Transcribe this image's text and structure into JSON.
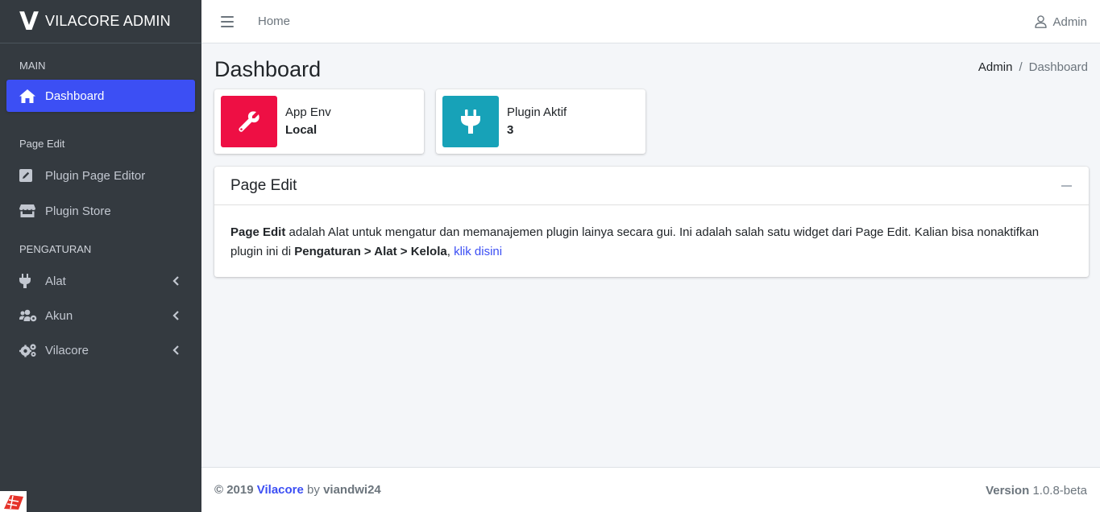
{
  "brand": {
    "logo": "V",
    "name": "VILACORE ADMIN"
  },
  "sidebar": {
    "sections": [
      {
        "header": "MAIN"
      },
      {
        "header": "Page Edit"
      },
      {
        "header": "PENGATURAN"
      }
    ],
    "items": [
      {
        "label": "Dashboard",
        "icon": "home-icon",
        "active": true
      },
      {
        "label": "Plugin Page Editor",
        "icon": "edit-icon"
      },
      {
        "label": "Plugin Store",
        "icon": "store-icon"
      },
      {
        "label": "Alat",
        "icon": "plug-icon",
        "expandable": true
      },
      {
        "label": "Akun",
        "icon": "users-cog-icon",
        "expandable": true
      },
      {
        "label": "Vilacore",
        "icon": "cogs-icon",
        "expandable": true
      }
    ]
  },
  "topbar": {
    "home_label": "Home",
    "user_label": "Admin"
  },
  "page": {
    "title": "Dashboard",
    "breadcrumb": {
      "home": "Admin",
      "separator": "/",
      "current": "Dashboard"
    }
  },
  "info_boxes": [
    {
      "label": "App Env",
      "value": "Local",
      "icon": "wrench-icon",
      "color": "#ee0f44"
    },
    {
      "label": "Plugin Aktif",
      "value": "3",
      "icon": "plug-icon",
      "color": "#17a2b8"
    }
  ],
  "card": {
    "title": "Page Edit",
    "body": {
      "strong_start": "Page Edit",
      "text1": " adalah Alat untuk mengatur dan memanajemen plugin lainya secara gui. Ini adalah salah satu widget dari Page Edit. Kalian bisa nonaktifkan plugin ini di ",
      "path": "Pengaturan > Alat > Kelola",
      "text2": ", ",
      "link": "klik disini"
    }
  },
  "footer": {
    "copyright": "© 2019",
    "brand_link": "Vilacore",
    "by": "by",
    "author": "viandwi24",
    "version_label": "Version",
    "version": "1.0.8-beta"
  },
  "colors": {
    "accent": "#3c4ff4",
    "sidebar_bg": "#343a40",
    "danger": "#ee0f44",
    "info": "#17a2b8"
  }
}
